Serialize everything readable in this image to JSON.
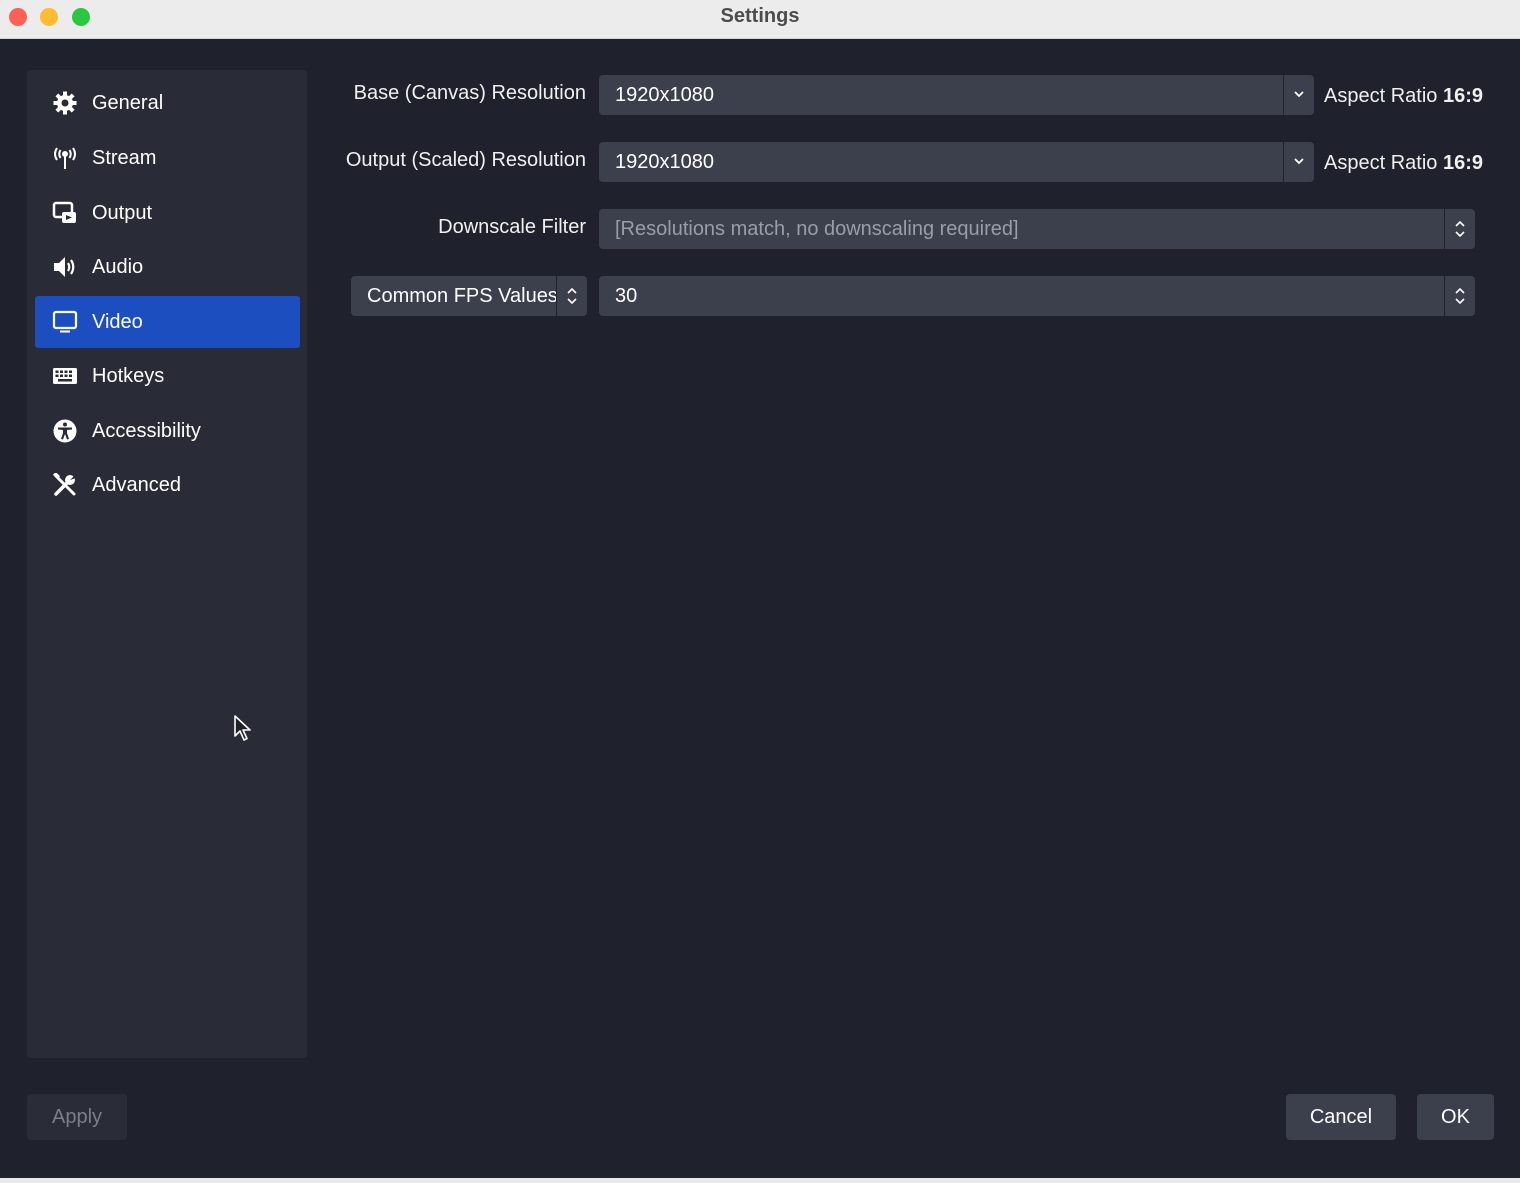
{
  "window": {
    "title": "Settings"
  },
  "sidebar": {
    "items": [
      {
        "label": "General",
        "icon": "gear-icon",
        "active": false
      },
      {
        "label": "Stream",
        "icon": "antenna-icon",
        "active": false
      },
      {
        "label": "Output",
        "icon": "output-icon",
        "active": false
      },
      {
        "label": "Audio",
        "icon": "speaker-icon",
        "active": false
      },
      {
        "label": "Video",
        "icon": "monitor-icon",
        "active": true
      },
      {
        "label": "Hotkeys",
        "icon": "keyboard-icon",
        "active": false
      },
      {
        "label": "Accessibility",
        "icon": "accessibility-icon",
        "active": false
      },
      {
        "label": "Advanced",
        "icon": "tools-icon",
        "active": false
      }
    ]
  },
  "video": {
    "base_resolution": {
      "label": "Base (Canvas) Resolution",
      "value": "1920x1080",
      "aspect_prefix": "Aspect Ratio",
      "aspect_value": "16:9"
    },
    "output_resolution": {
      "label": "Output (Scaled) Resolution",
      "value": "1920x1080",
      "aspect_prefix": "Aspect Ratio",
      "aspect_value": "16:9"
    },
    "downscale_filter": {
      "label": "Downscale Filter",
      "value": "[Resolutions match, no downscaling required]"
    },
    "fps": {
      "type_label": "Common FPS Values",
      "value": "30"
    }
  },
  "buttons": {
    "apply": "Apply",
    "cancel": "Cancel",
    "ok": "OK"
  },
  "colors": {
    "accent": "#1c4ec0",
    "background": "#1f222c",
    "sidebar": "#292c36",
    "control": "#3c404d"
  }
}
